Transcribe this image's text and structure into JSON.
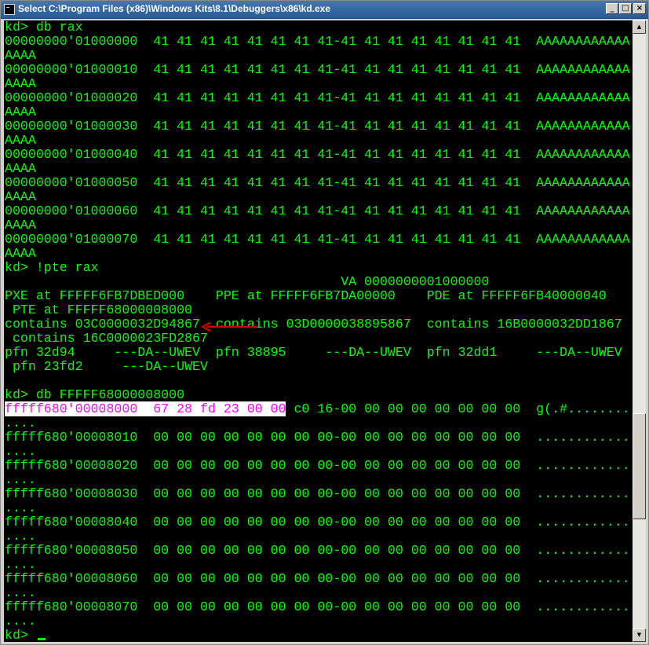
{
  "window": {
    "title": "Select C:\\Program Files (x86)\\Windows Kits\\8.1\\Debuggers\\x86\\kd.exe",
    "min_glyph": "_",
    "max_glyph": "□",
    "close_glyph": "×"
  },
  "scrollbar": {
    "up_glyph": "▲",
    "down_glyph": "▼"
  },
  "colors": {
    "console_background": "#000000",
    "console_text": "#00ff00",
    "selection_background": "#ffffff",
    "selection_text": "#ff00ff",
    "annotation_arrow": "#cc0000"
  },
  "console": {
    "lines": [
      "kd> db rax",
      "00000000'01000000  41 41 41 41 41 41 41 41-41 41 41 41 41 41 41 41  AAAAAAAAAAAA",
      "AAAA",
      "00000000'01000010  41 41 41 41 41 41 41 41-41 41 41 41 41 41 41 41  AAAAAAAAAAAA",
      "AAAA",
      "00000000'01000020  41 41 41 41 41 41 41 41-41 41 41 41 41 41 41 41  AAAAAAAAAAAA",
      "AAAA",
      "00000000'01000030  41 41 41 41 41 41 41 41-41 41 41 41 41 41 41 41  AAAAAAAAAAAA",
      "AAAA",
      "00000000'01000040  41 41 41 41 41 41 41 41-41 41 41 41 41 41 41 41  AAAAAAAAAAAA",
      "AAAA",
      "00000000'01000050  41 41 41 41 41 41 41 41-41 41 41 41 41 41 41 41  AAAAAAAAAAAA",
      "AAAA",
      "00000000'01000060  41 41 41 41 41 41 41 41-41 41 41 41 41 41 41 41  AAAAAAAAAAAA",
      "AAAA",
      "00000000'01000070  41 41 41 41 41 41 41 41-41 41 41 41 41 41 41 41  AAAAAAAAAAAA",
      "AAAA",
      "kd> !pte rax",
      "                                           VA 0000000001000000",
      "PXE at FFFFF6FB7DBED000    PPE at FFFFF6FB7DA00000    PDE at FFFFF6FB40000040",
      " PTE at FFFFF68000008000",
      "contains 03C0000032D94867  contains 03D0000038895867  contains 16B0000032DD1867",
      " contains 16C0000023FD2867",
      "pfn 32d94     ---DA--UWEV  pfn 38895     ---DA--UWEV  pfn 32dd1     ---DA--UWEV",
      " pfn 23fd2     ---DA--UWEV",
      "",
      "kd> db FFFFF68000008000"
    ],
    "selected_line": {
      "highlighted": "fffff680'00008000  67 28 fd 23 00 00",
      "rest": " c0 16-00 00 00 00 00 00 00 00  g(.#........"
    },
    "lines_after": [
      "....",
      "fffff680'00008010  00 00 00 00 00 00 00 00-00 00 00 00 00 00 00 00  ............",
      "....",
      "fffff680'00008020  00 00 00 00 00 00 00 00-00 00 00 00 00 00 00 00  ............",
      "....",
      "fffff680'00008030  00 00 00 00 00 00 00 00-00 00 00 00 00 00 00 00  ............",
      "....",
      "fffff680'00008040  00 00 00 00 00 00 00 00-00 00 00 00 00 00 00 00  ............",
      "....",
      "fffff680'00008050  00 00 00 00 00 00 00 00-00 00 00 00 00 00 00 00  ............",
      "....",
      "fffff680'00008060  00 00 00 00 00 00 00 00-00 00 00 00 00 00 00 00  ............",
      "....",
      "fffff680'00008070  00 00 00 00 00 00 00 00-00 00 00 00 00 00 00 00  ............",
      "....",
      "kd> "
    ]
  }
}
